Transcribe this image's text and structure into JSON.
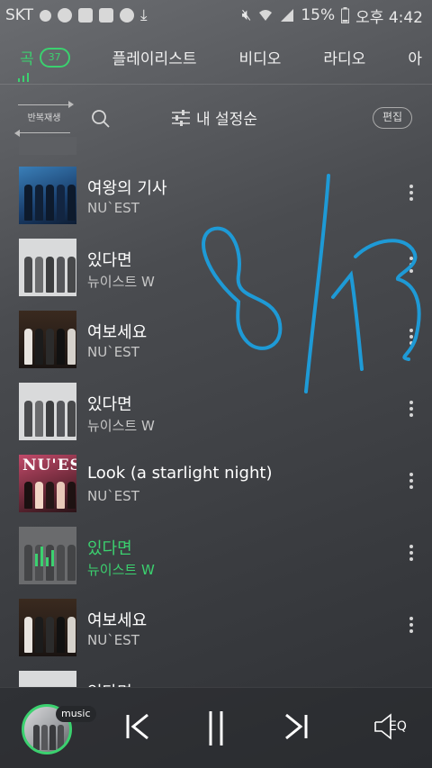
{
  "status": {
    "carrier": "SKT",
    "battery": "15%",
    "time": "오후 4:42"
  },
  "tabs": [
    {
      "label": "곡",
      "count": "37"
    },
    {
      "label": "플레이리스트"
    },
    {
      "label": "비디오"
    },
    {
      "label": "라디오"
    },
    {
      "label": "아"
    }
  ],
  "toolbar": {
    "repeat_label": "반복재생",
    "sort_label": "내 설정순",
    "edit_label": "편집"
  },
  "songs": [
    {
      "title": "여왕의 기사",
      "artist": "NU`EST"
    },
    {
      "title": "있다면",
      "artist": "뉴이스트 W"
    },
    {
      "title": "여보세요",
      "artist": "NU`EST"
    },
    {
      "title": "있다면",
      "artist": "뉴이스트 W"
    },
    {
      "title": "Look (a starlight night)",
      "artist": "NU`EST"
    },
    {
      "title": "있다면",
      "artist": "뉴이스트 W"
    },
    {
      "title": "여보세요",
      "artist": "NU`EST"
    },
    {
      "title": "있다면",
      "artist": ""
    }
  ],
  "album_art": {
    "nuest_logo": "NU'EST"
  },
  "player": {
    "badge": "music",
    "eq_label": "EQ"
  },
  "colors": {
    "accent": "#3bd16f",
    "annotation": "#1e9ad6"
  }
}
